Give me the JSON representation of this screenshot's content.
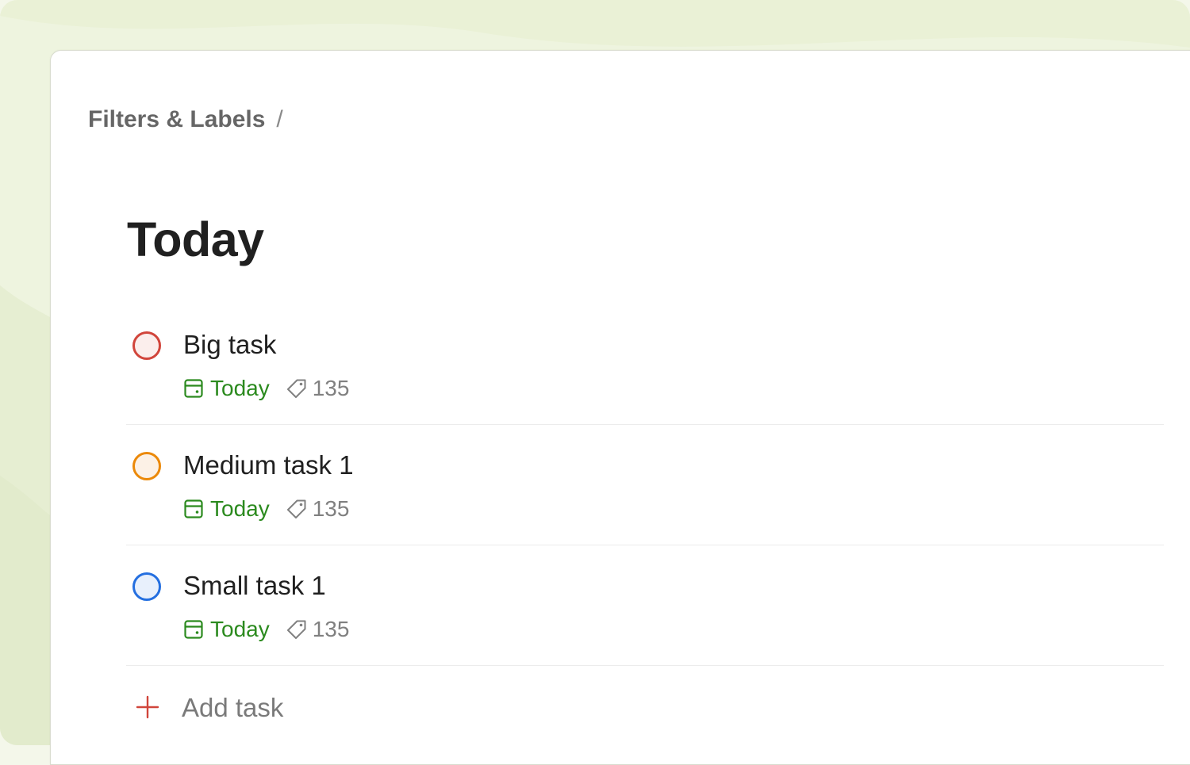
{
  "breadcrumb": {
    "parent": "Filters & Labels",
    "separator": "/"
  },
  "page": {
    "title": "Today"
  },
  "tasks": [
    {
      "title": "Big task",
      "priority_color": "#d1453b",
      "priority_fill": "#fbeeec",
      "due": "Today",
      "label": "135"
    },
    {
      "title": "Medium task 1",
      "priority_color": "#eb8909",
      "priority_fill": "#fcf1e6",
      "due": "Today",
      "label": "135"
    },
    {
      "title": "Small task 1",
      "priority_color": "#246fe0",
      "priority_fill": "#e8f0fc",
      "due": "Today",
      "label": "135"
    }
  ],
  "add_task": {
    "label": "Add task",
    "icon_color": "#d1453b"
  },
  "icons": {
    "due": "calendar-icon",
    "label": "tag-icon",
    "add": "plus-icon"
  },
  "colors": {
    "due_green": "#2b8a1e",
    "muted_gray": "#808080"
  }
}
